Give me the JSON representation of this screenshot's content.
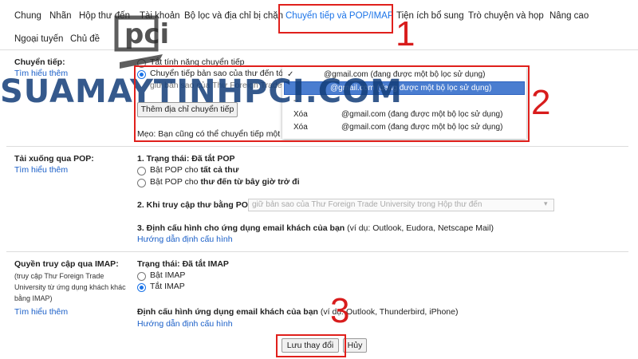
{
  "tabs": [
    {
      "label": "Chung"
    },
    {
      "label": "Nhãn"
    },
    {
      "label": "Hộp thư đến"
    },
    {
      "label": "Tài khoản"
    },
    {
      "label": "Bộ lọc và địa chỉ bị chặn"
    },
    {
      "label": "Chuyển tiếp và POP/IMAP"
    },
    {
      "label": "Tiện ích bổ sung"
    },
    {
      "label": "Trò chuyện và họp"
    },
    {
      "label": "Nâng cao"
    },
    {
      "label": "Ngoại tuyến"
    },
    {
      "label": "Chủ đề"
    }
  ],
  "forwarding": {
    "label": "Chuyển tiếp:",
    "learn_more": "Tìm hiểu thêm",
    "option_disable": "Tắt tính năng chuyển tiếp",
    "option_forward": "Chuyển tiếp bản sao của thư đến tới",
    "option_keep": "giữ bản sao của Thư Foreign Trade",
    "add_button": "Thêm địa chỉ chuyển tiếp",
    "tip": "Mẹo: Bạn cũng có thể chuyển tiếp một"
  },
  "dropdown": {
    "items": [
      {
        "prefix": "✓",
        "text": "@gmail.com (đang được một bộ lọc sử dụng)"
      },
      {
        "prefix": "",
        "text": "@gmail.com (đang được một bộ lọc sử dụng)"
      },
      {
        "prefix": "--",
        "text": ""
      },
      {
        "prefix": "Xóa",
        "text": "@gmail.com (đang được một bộ lọc sử dụng)"
      },
      {
        "prefix": "Xóa",
        "text": "@gmail.com (đang được một bộ lọc sử dụng)"
      }
    ]
  },
  "pop": {
    "label": "Tải xuống qua POP:",
    "learn_more": "Tìm hiểu thêm",
    "status": "1. Trạng thái: Đã tắt POP",
    "opt1_prefix": "Bật POP cho ",
    "opt1_bold": "tất cả thư",
    "opt2_prefix": "Bật POP cho ",
    "opt2_bold": "thư đến từ bây giờ trở đi",
    "access_label": "2. Khi truy cập thư bằng POP",
    "access_select": "giữ bản sao của Thư Foreign Trade University trong Hộp thư đến",
    "config_label": "3. Định cấu hình cho ứng dụng email khách của bạn",
    "config_example": " (ví dụ: Outlook, Eudora, Netscape Mail)",
    "config_link": "Hướng dẫn định cấu hình"
  },
  "imap": {
    "label": "Quyền truy cập qua IMAP:",
    "desc1": "(truy cập Thư Foreign Trade",
    "desc2": "University từ ứng dụng khách khác",
    "desc3": "bằng IMAP)",
    "learn_more": "Tìm hiểu thêm",
    "status": "Trạng thái: Đã tắt IMAP",
    "opt_on": "Bật IMAP",
    "opt_off": "Tắt IMAP",
    "config_label": "Định cấu hình ứng dụng email khách của bạn",
    "config_example": " (ví dụ: Outlook, Thunderbird, iPhone)",
    "config_link": "Hướng dẫn định cấu hình"
  },
  "actions": {
    "save": "Lưu thay đổi",
    "cancel": "Hủy"
  },
  "annotations": {
    "n1": "1",
    "n2": "2",
    "n3": "3"
  },
  "watermark": {
    "text": "SUAMAYTINHPCI.COM",
    "logo": "pci"
  },
  "colors": {
    "link": "#1a5fc8",
    "active_tab": "#1a73e8",
    "highlight": "#4a7dd0",
    "annotation": "#e0201c"
  }
}
